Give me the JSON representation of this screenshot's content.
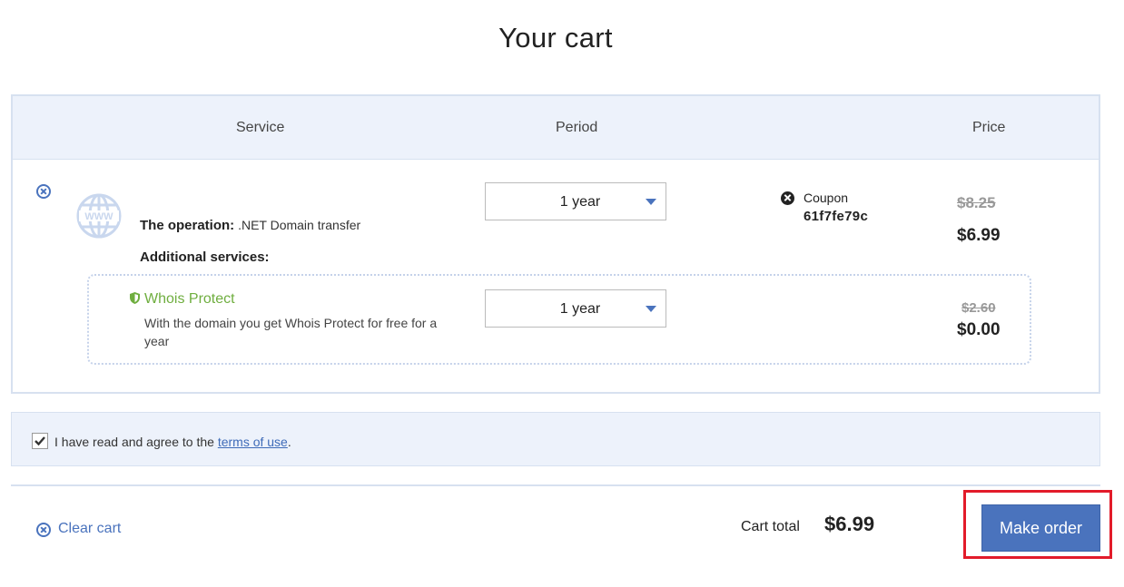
{
  "page": {
    "title": "Your cart"
  },
  "table": {
    "headers": {
      "service": "Service",
      "period": "Period",
      "price": "Price"
    }
  },
  "item": {
    "domain_name": "",
    "operation_label": "The operation:",
    "operation_value": ".NET Domain transfer",
    "additional_label": "Additional services:",
    "period_value": "1 year",
    "coupon_label": "Coupon",
    "coupon_code": "61f7fe79c",
    "price_old": "$8.25",
    "price_new": "$6.99"
  },
  "addon": {
    "title": "Whois Protect",
    "description": "With the domain you get Whois Protect for free for a year",
    "period_value": "1 year",
    "price_old": "$2.60",
    "price_new": "$0.00"
  },
  "agreement": {
    "checked": true,
    "text": "I have read and agree to the",
    "link": "terms of use",
    "suffix": "."
  },
  "footer": {
    "clear_cart": "Clear cart",
    "total_label": "Cart total",
    "total_value": "$6.99",
    "order_button": "Make order"
  },
  "colors": {
    "accent": "#4a73bd",
    "whois_green": "#6fae3f",
    "highlight_red": "#e21b2a",
    "header_bg": "#edf2fb"
  },
  "icons": {
    "remove_item": "remove-circle-icon",
    "domain": "www-globe-icon",
    "dropdown": "chevron-down-icon",
    "coupon_remove": "close-circle-icon",
    "whois": "shield-icon",
    "checkbox": "checkmark-icon"
  }
}
